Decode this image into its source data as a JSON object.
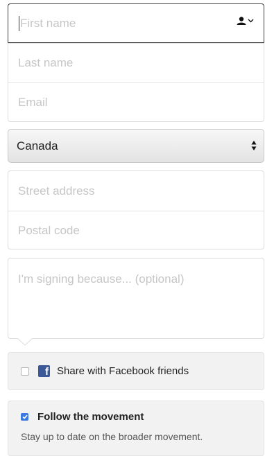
{
  "form": {
    "first_name": {
      "placeholder": "First name",
      "icon": "contact-card-icon"
    },
    "last_name": {
      "placeholder": "Last name"
    },
    "email": {
      "placeholder": "Email"
    },
    "country": {
      "value": "Canada",
      "icon": "select-arrows-icon"
    },
    "street_address": {
      "placeholder": "Street address"
    },
    "postal_code": {
      "placeholder": "Postal code"
    },
    "comment": {
      "placeholder": "I'm signing because... (optional)"
    }
  },
  "share": {
    "label": "Share with Facebook friends",
    "checked": false,
    "icon": "facebook-icon",
    "brand_color": "#3b5998"
  },
  "follow": {
    "label": "Follow the movement",
    "checked": true,
    "description": "Stay up to date on the broader movement.",
    "check_color": "#3b7be0"
  }
}
